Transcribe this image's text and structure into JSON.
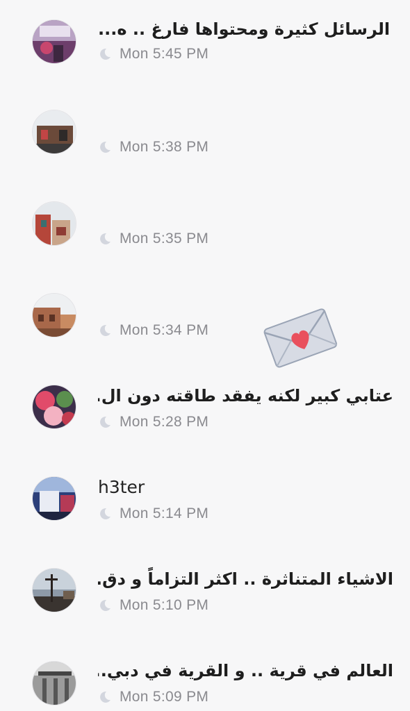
{
  "conversations": [
    {
      "title": "الرسائل كثيرة ومحتواها فارغ .. ه...",
      "dir": "rtl",
      "time": "Mon 5:45 PM"
    },
    {
      "title": "",
      "dir": "rtl",
      "time": "Mon 5:38 PM"
    },
    {
      "title": "",
      "dir": "rtl",
      "time": "Mon 5:35 PM"
    },
    {
      "title": "",
      "dir": "rtl",
      "time": "Mon 5:34 PM"
    },
    {
      "title": "عتابي كبير لكنه يفقد طاقته دون ال...",
      "dir": "rtl",
      "time": "Mon 5:28 PM"
    },
    {
      "title": "h3ter",
      "dir": "ltr",
      "time": "Mon 5:14 PM"
    },
    {
      "title": "الاشياء المتناثرة .. اكثر التزاماً و دق...",
      "dir": "rtl",
      "time": "Mon 5:10 PM"
    },
    {
      "title": "العالم في قرية .. و القرية في دبي...",
      "dir": "rtl",
      "time": "Mon 5:09 PM"
    }
  ],
  "icons": {
    "status": "moon-icon",
    "overlay": "love-letter-icon"
  },
  "colors": {
    "background": "#f7f7f8",
    "title": "#1e1e1e",
    "time": "#8a8a8f",
    "moon": "#d3d6de",
    "heart": "#e9505d"
  }
}
